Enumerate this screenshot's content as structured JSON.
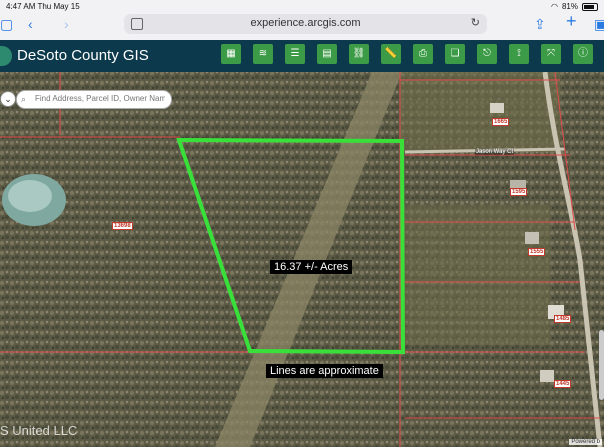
{
  "status": {
    "time": "4:47 AM",
    "date": "Thu May 15",
    "battery": "81%"
  },
  "browser": {
    "url": "experience.arcgis.com"
  },
  "app": {
    "title": "DeSoto County GIS"
  },
  "toolbar": [
    {
      "name": "basemap-gallery-icon",
      "glyph": "▦"
    },
    {
      "name": "layers-icon",
      "glyph": "≋"
    },
    {
      "name": "layer-list-icon",
      "glyph": "☰"
    },
    {
      "name": "table-icon",
      "glyph": "▤"
    },
    {
      "name": "link-icon",
      "glyph": "⛓"
    },
    {
      "name": "measure-icon",
      "glyph": "📏"
    },
    {
      "name": "print-icon",
      "glyph": "⎙"
    },
    {
      "name": "bookmark-icon",
      "glyph": "❏"
    },
    {
      "name": "share-icon",
      "glyph": "⎋"
    },
    {
      "name": "analysis-icon",
      "glyph": "⟟"
    },
    {
      "name": "directions-icon",
      "glyph": "⤧"
    },
    {
      "name": "info-icon",
      "glyph": "ⓘ"
    }
  ],
  "search": {
    "placeholder": "Find Address, Parcel ID, Owner Nam..."
  },
  "map": {
    "acreage_label": "16.37 +/- Acres",
    "note_label": "Lines are approximate",
    "street_label": "Jason Way Ct",
    "watermark": "S United LLC",
    "powered_by": "Powered b",
    "parcel_numbers": [
      "1665",
      "13698",
      "1595",
      "1555",
      "1485",
      "1445"
    ]
  },
  "colors": {
    "header": "#0c3a4c",
    "button": "#3c9b46",
    "boundary": "#39e03a",
    "parcel_lines": "#e04b4b"
  }
}
